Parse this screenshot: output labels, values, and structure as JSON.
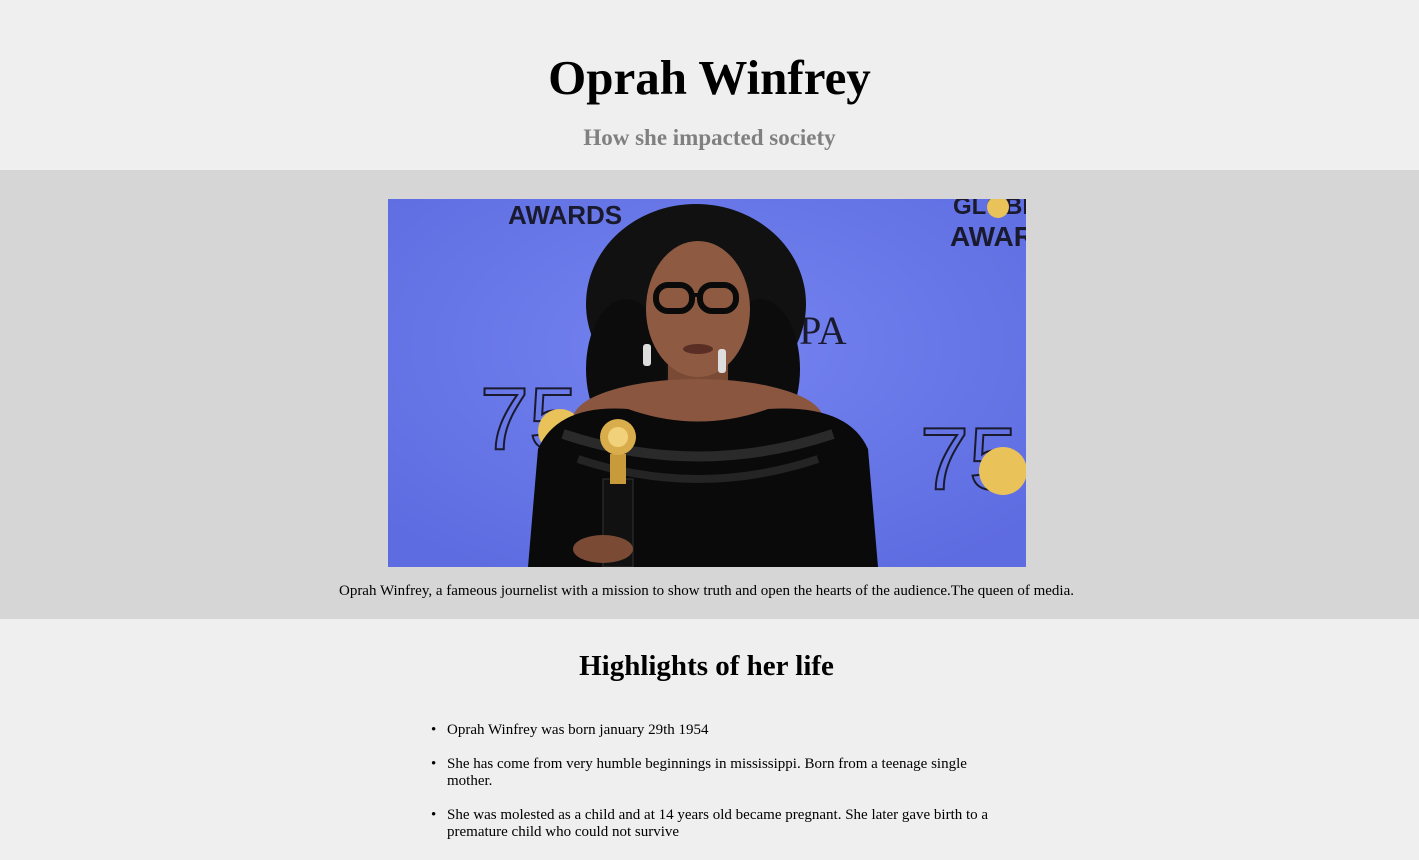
{
  "header": {
    "title": "Oprah Winfrey",
    "subtitle": "How she impacted society"
  },
  "hero": {
    "photo_description_icon": "portrait-photo",
    "photo_text": {
      "awards_left": "AWARDS",
      "awards_right_top": "GLOBE",
      "awards_right": "AWARD",
      "hfpa": "HFPA",
      "seventy_five": "75"
    },
    "caption": "Oprah Winfrey, a fameous journelist with a mission to show truth and open the hearts of the audience.The queen of media."
  },
  "highlights": {
    "title": "Highlights of her life",
    "items": [
      "Oprah Winfrey was born january 29th 1954",
      "She has come from very humble beginnings in mississippi. Born from a teenage single mother.",
      "She was molested as a child and at 14 years old became pregnant. She later gave birth to a premature child who could not survive"
    ]
  },
  "colors": {
    "page_bg": "#efefef",
    "hero_bg": "#d6d6d6",
    "photo_bg": "#6a78e6",
    "subtitle": "#808080"
  }
}
